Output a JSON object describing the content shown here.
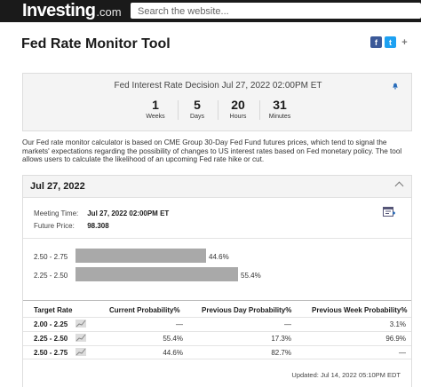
{
  "header": {
    "logo_main": "Investing",
    "logo_suffix": ".com",
    "search_placeholder": "Search the website..."
  },
  "page": {
    "title": "Fed Rate Monitor Tool",
    "share": {
      "facebook": "f",
      "twitter": "t",
      "more": "+"
    }
  },
  "countdown": {
    "title": "Fed Interest Rate Decision Jul 27, 2022 02:00PM ET",
    "units": [
      {
        "value": "1",
        "label": "Weeks"
      },
      {
        "value": "5",
        "label": "Days"
      },
      {
        "value": "20",
        "label": "Hours"
      },
      {
        "value": "31",
        "label": "Minutes"
      }
    ]
  },
  "description": "Our Fed rate monitor calculator is based on CME Group 30-Day Fed Fund futures prices, which tend to signal the markets' expectations regarding the possibility of changes to US interest rates based on Fed monetary policy. The tool allows users to calculate the likelihood of an upcoming Fed rate hike or cut.",
  "meeting": {
    "date": "Jul 27, 2022",
    "meeting_time_label": "Meeting Time:",
    "meeting_time_value": "Jul 27, 2022 02:00PM ET",
    "future_price_label": "Future Price:",
    "future_price_value": "98.308",
    "bars": [
      {
        "label": "2.50 - 2.75",
        "value_text": "44.6%",
        "value": 44.6
      },
      {
        "label": "2.25 - 2.50",
        "value_text": "55.4%",
        "value": 55.4
      }
    ],
    "table": {
      "headers": [
        "Target Rate",
        "Current Probability%",
        "Previous Day Probability%",
        "Previous Week Probability%"
      ],
      "rows": [
        {
          "target": "2.00 - 2.25",
          "current": "—",
          "prev_day": "—",
          "prev_week": "3.1%"
        },
        {
          "target": "2.25 - 2.50",
          "current": "55.4%",
          "prev_day": "17.3%",
          "prev_week": "96.9%"
        },
        {
          "target": "2.50 - 2.75",
          "current": "44.6%",
          "prev_day": "82.7%",
          "prev_week": "—"
        }
      ]
    },
    "updated": "Updated: Jul 14, 2022 05:10PM EDT"
  },
  "colors": {
    "topbar": "#1a1a1a",
    "bar": "#a9a9a9",
    "facebook": "#3b5998",
    "twitter": "#1da1f2",
    "bell": "#2a6ebb"
  }
}
